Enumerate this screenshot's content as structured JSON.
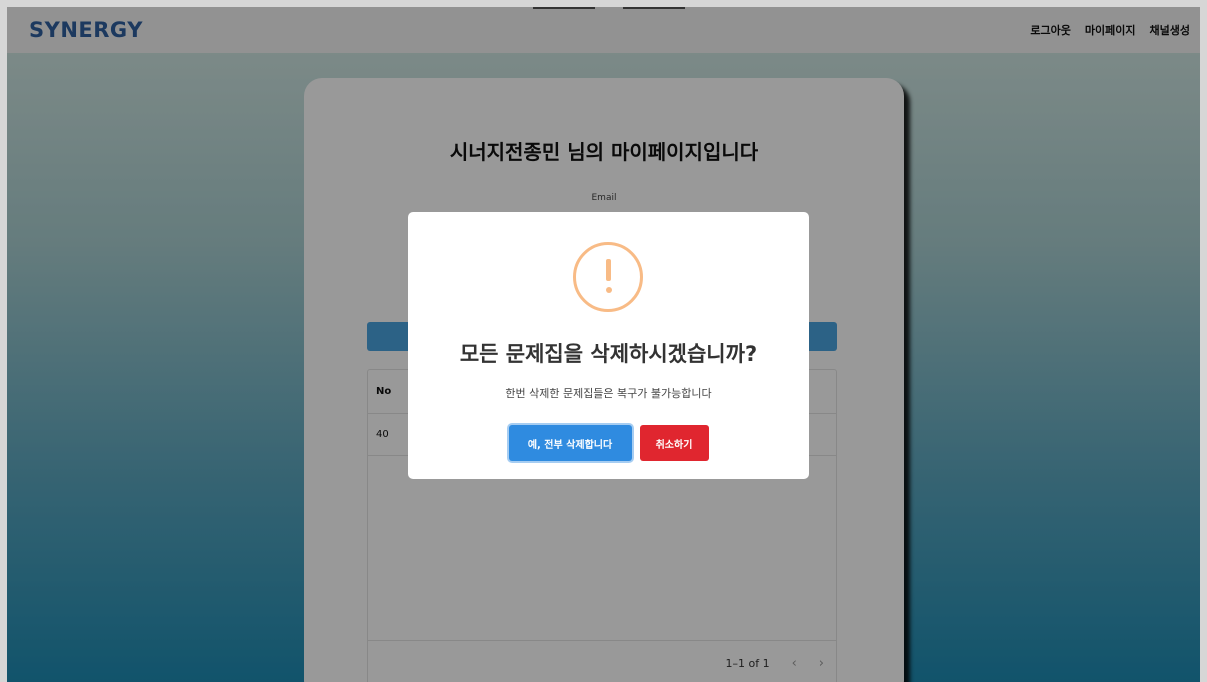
{
  "navbar": {
    "logo": "SYNERGY",
    "links": [
      "로그아웃",
      "마이페이지",
      "채널생성"
    ]
  },
  "card": {
    "title": "시너지전종민 님의 마이페이지입니다",
    "email_label": "Email",
    "table": {
      "header": "No",
      "rows": [
        "40"
      ],
      "pagination": {
        "range": "1–1 of 1",
        "prev_icon": "chevron-left-icon",
        "next_icon": "chevron-right-icon"
      }
    }
  },
  "modal": {
    "icon": "warning-icon",
    "title": "모든 문제집을 삭제하시겠습니까?",
    "text": "한번 삭제한 문제집들은 복구가 불가능합니다",
    "confirm_label": "예, 전부 삭제합니다",
    "cancel_label": "취소하기"
  },
  "colors": {
    "accent": "#2f8be0",
    "danger": "#e0262f",
    "warning": "#f8bb86",
    "logo": "#2f5f9e"
  }
}
